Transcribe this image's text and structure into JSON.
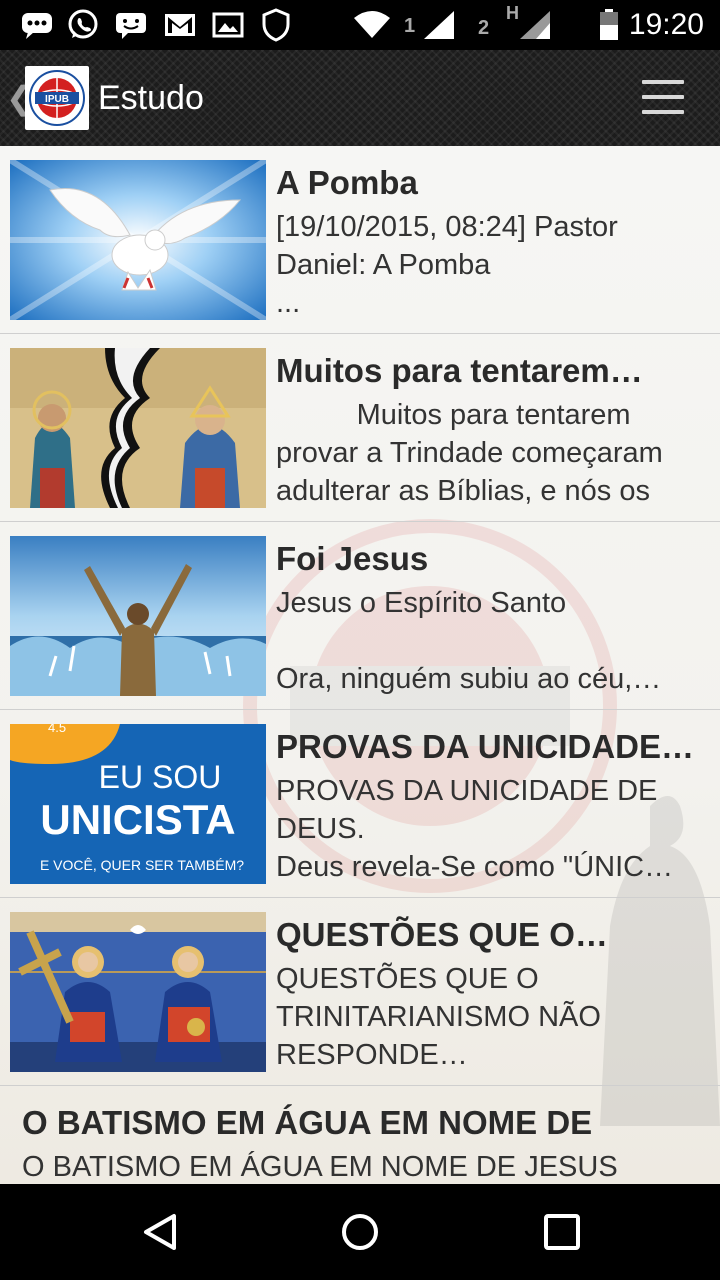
{
  "status_bar": {
    "time": "19:20",
    "sim1": "1",
    "sim2": "2",
    "network_type": "H"
  },
  "app_bar": {
    "title": "Estudo",
    "logo_text": "IPUB"
  },
  "items": [
    {
      "title": "A Pomba",
      "description": "[19/10/2015, 08:24] Pastor Daniel: A Pomba\n..."
    },
    {
      "title": "Muitos para tentarem…",
      "description": "          Muitos para tentarem provar a Trindade começaram adulterar as Bíblias, e nós os"
    },
    {
      "title": "Foi Jesus",
      "description": "Jesus o Espírito Santo\n\nOra, ninguém subiu ao céu,…"
    },
    {
      "title": "PROVAS DA UNICIDADE…",
      "description": "PROVAS DA UNICIDADE DE DEUS.\nDeus revela-Se como \"ÚNIC…",
      "thumb_text": {
        "badge": "4.5",
        "line1": "EU SOU",
        "line2": "UNICISTA",
        "line3": "E VOCÊ,  QUER SER TAMBÉM?"
      }
    },
    {
      "title": "QUESTÕES QUE O…",
      "description": "QUESTÕES QUE O TRINITARIANISMO NÃO RESPONDE…"
    },
    {
      "title": "O BATISMO EM ÁGUA EM NOME DE",
      "description": "O BATISMO EM ÁGUA EM NOME DE JESUS"
    }
  ],
  "colors": {
    "app_bar": "#1c1c1c",
    "content_bg": "#f5f4f0",
    "title_text": "#2a2a2a",
    "unicista_blue": "#1565b5",
    "unicista_orange": "#f5a623"
  }
}
